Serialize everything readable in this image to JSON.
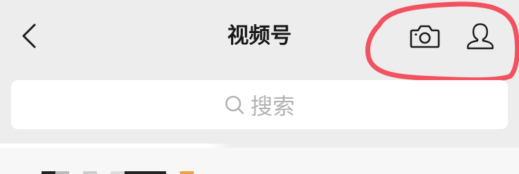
{
  "nav": {
    "title": "视频号",
    "back_icon": "chevron-left-icon",
    "camera_icon": "camera-icon",
    "profile_icon": "person-icon"
  },
  "highlight": {
    "color": "#f2525f"
  },
  "search": {
    "placeholder": "搜索",
    "icon": "search-icon"
  },
  "colors": {
    "background": "#ededed",
    "title": "#191919",
    "placeholder": "#b2b2b2",
    "icon": "#1a1a1a"
  }
}
